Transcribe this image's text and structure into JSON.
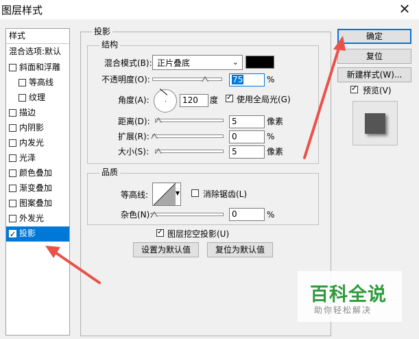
{
  "window": {
    "title": "图层样式",
    "close_glyph": "✕"
  },
  "sidebar": {
    "header": "样式",
    "blend_options": "混合选项:默认",
    "items": [
      {
        "label": "斜面和浮雕",
        "checked": false,
        "indent": false
      },
      {
        "label": "等高线",
        "checked": false,
        "indent": true
      },
      {
        "label": "纹理",
        "checked": false,
        "indent": true
      },
      {
        "label": "描边",
        "checked": false,
        "indent": false
      },
      {
        "label": "内阴影",
        "checked": false,
        "indent": false
      },
      {
        "label": "内发光",
        "checked": false,
        "indent": false
      },
      {
        "label": "光泽",
        "checked": false,
        "indent": false
      },
      {
        "label": "颜色叠加",
        "checked": false,
        "indent": false
      },
      {
        "label": "渐变叠加",
        "checked": false,
        "indent": false
      },
      {
        "label": "图案叠加",
        "checked": false,
        "indent": false
      },
      {
        "label": "外发光",
        "checked": false,
        "indent": false
      },
      {
        "label": "投影",
        "checked": true,
        "indent": false,
        "selected": true
      }
    ]
  },
  "drop_shadow": {
    "section_title": "投影",
    "structure": {
      "title": "结构",
      "blend_mode_label": "混合模式(B):",
      "blend_mode_value": "正片叠底",
      "color": "#000000",
      "opacity_label": "不透明度(O):",
      "opacity_value": "75",
      "opacity_unit": "%",
      "opacity_fraction": 0.75,
      "angle_label": "角度(A):",
      "angle_value": "120",
      "angle_unit": "度",
      "global_light_label": "使用全局光(G)",
      "global_light_checked": true,
      "distance_label": "距离(D):",
      "distance_value": "5",
      "distance_unit": "像素",
      "spread_label": "扩展(R):",
      "spread_value": "0",
      "spread_unit": "%",
      "size_label": "大小(S):",
      "size_value": "5",
      "size_unit": "像素"
    },
    "quality": {
      "title": "品质",
      "contour_label": "等高线:",
      "anti_alias_label": "消除锯齿(L)",
      "anti_alias_checked": false,
      "noise_label": "杂色(N):",
      "noise_value": "0",
      "noise_unit": "%"
    },
    "knockout_label": "图层挖空投影(U)",
    "knockout_checked": true,
    "make_default": "设置为默认值",
    "reset_default": "复位为默认值"
  },
  "actions": {
    "ok": "确定",
    "reset": "复位",
    "new_style": "新建样式(W)...",
    "preview_label": "预览(V)",
    "preview_checked": true
  },
  "watermark": {
    "title": "百科全说",
    "subtitle": "助你轻松解决"
  },
  "colors": {
    "accent": "#0078d7",
    "arrow": "#e8524a",
    "watermark": "#2e9a3a"
  },
  "icons": {
    "arrow": "red-arrow-annotation"
  }
}
